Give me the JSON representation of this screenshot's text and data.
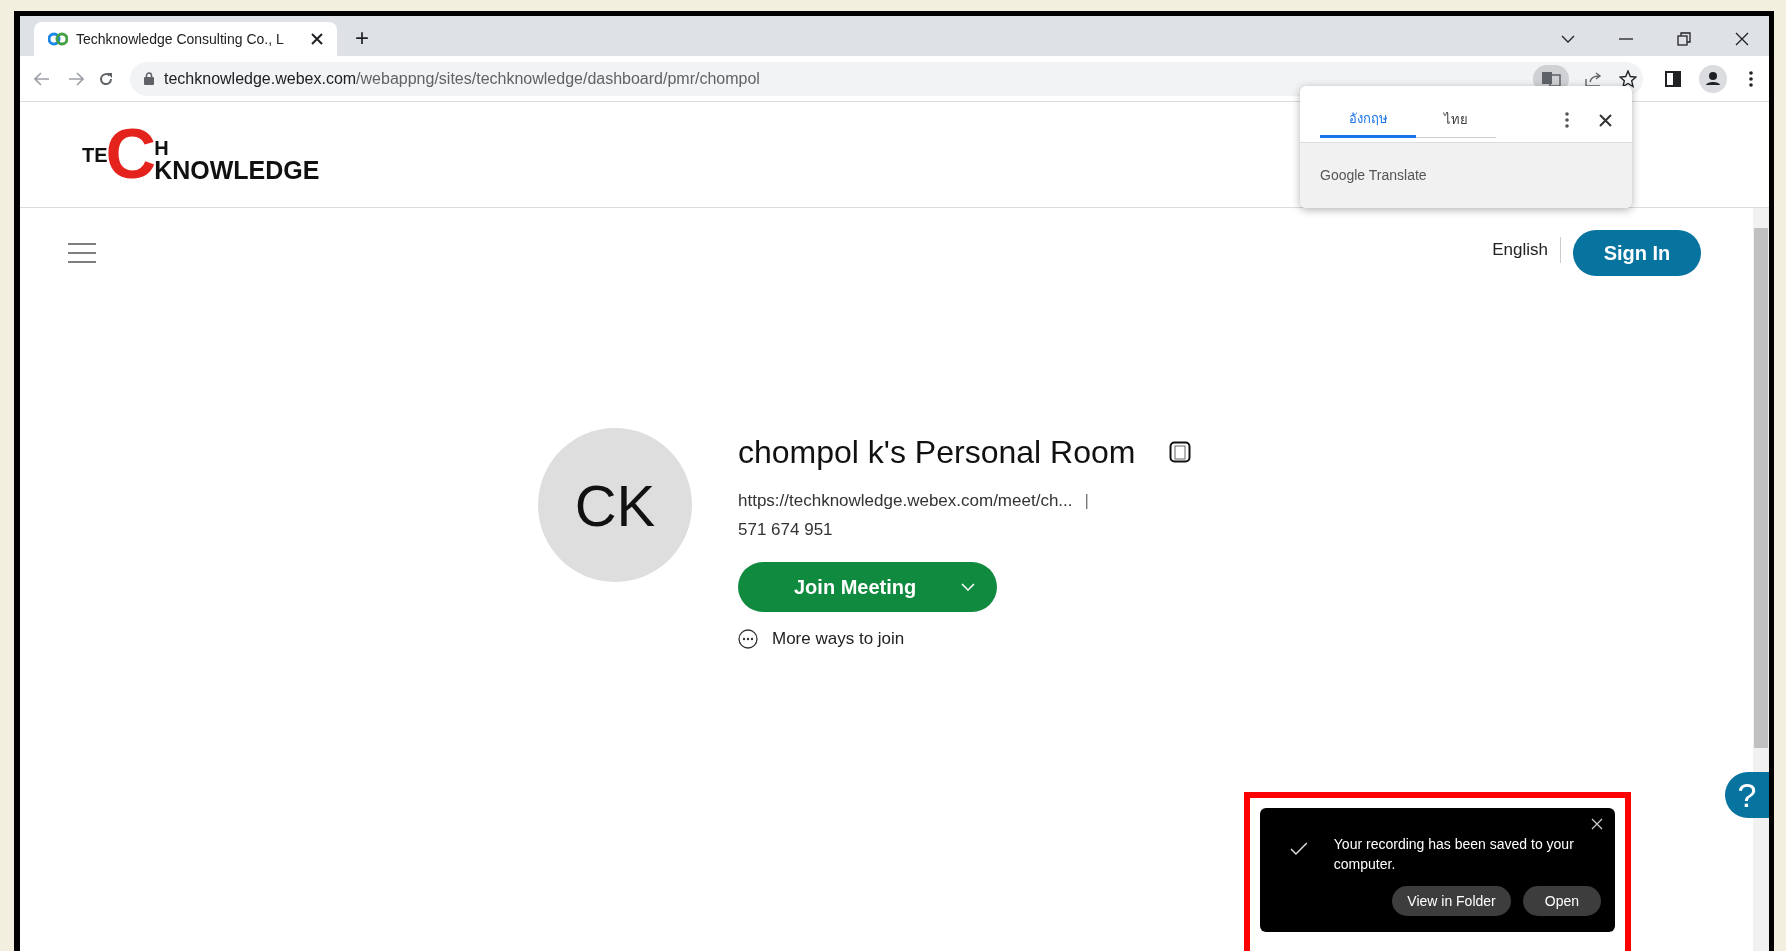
{
  "browser": {
    "tabs": [
      {
        "title": "Techknowledge Consulting Co., L",
        "selected": true
      }
    ],
    "new_tab": "+",
    "url": {
      "domain": "techknowledge.webex.com",
      "path": "/webappng/sites/techknowledge/dashboard/pmr/chompol"
    }
  },
  "translate_popup": {
    "tabs": [
      {
        "label": "อังกฤษ",
        "selected": true
      },
      {
        "label": "ไทย",
        "selected": false
      }
    ],
    "footer": "Google Translate"
  },
  "header": {
    "logo": {
      "left": "TE",
      "c": "C",
      "h": "H",
      "right": "KNOWLEDGE"
    }
  },
  "nav": {
    "language": "English",
    "sign_in": "Sign In"
  },
  "room": {
    "initials": "CK",
    "title": "chompol k's Personal Room",
    "link": "https://techknowledge.webex.com/meet/ch...",
    "separator": "|",
    "number": "571 674 951",
    "join": "Join Meeting",
    "more": "More ways to join"
  },
  "help": "?",
  "toast": {
    "message": "Your recording has been saved to your computer.",
    "buttons": [
      "View in Folder",
      "Open"
    ]
  }
}
